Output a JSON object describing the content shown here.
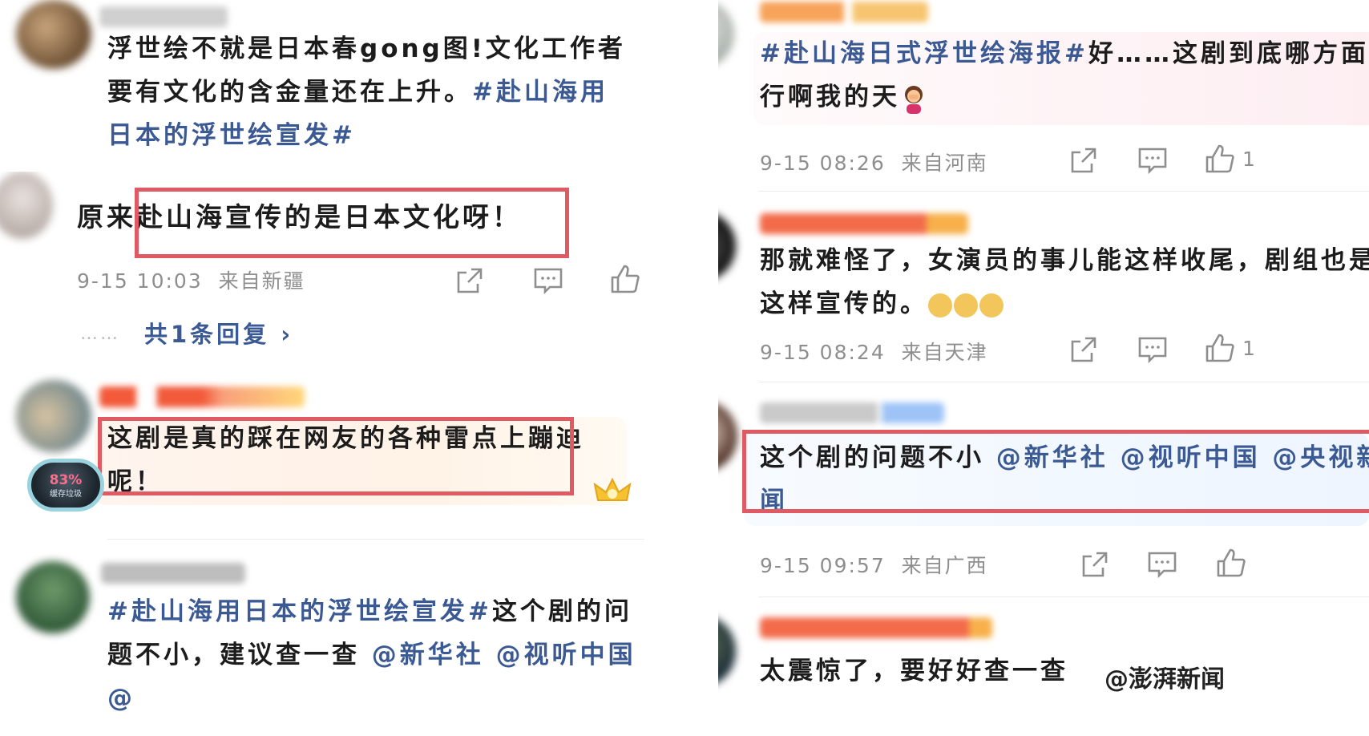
{
  "left": {
    "c1": {
      "text": "浮世绘不就是日本春gong图!文化工作者要有文化的含金量还在上升。",
      "tag": "#赴山海用日本的浮世绘宣发#"
    },
    "c2": {
      "prefix": "原来",
      "highlight": "赴山海宣传的是日本文化呀！",
      "time": "9-15 10:03",
      "location": "来自新疆",
      "replies_dots": "……",
      "replies": "共1条回复 ›"
    },
    "c3": {
      "text": "这剧是真的踩在网友的各种雷点上蹦迪呢！",
      "badge_pct": "83%",
      "badge_label": "缓存垃圾"
    },
    "c4": {
      "tag": "#赴山海用日本的浮世绘宣发#",
      "text": "这个剧的问题不小，建议查一查",
      "mentions": "@新华社 @视听中国 @"
    }
  },
  "right": {
    "c1": {
      "tag": "#赴山海日式浮世绘海报#",
      "text": "好……这剧到底哪方面行啊我的天",
      "time": "9-15 08:26",
      "location": "来自河南",
      "likes": "1"
    },
    "c2": {
      "text": "那就难怪了，女演员的事儿能这样收尾，剧组也是这样宣传的。",
      "time": "9-15 08:24",
      "location": "来自天津",
      "likes": "1"
    },
    "c3": {
      "text": "这个剧的问题不小",
      "mentions": "@新华社 @视听中国 @央视新闻",
      "time": "9-15 09:57",
      "location": "来自广西"
    },
    "c4": {
      "text": "太震惊了，要好好查一查",
      "watermark": "@澎湃新闻"
    }
  },
  "colors": {
    "text": "#1c1c1c",
    "link": "#3b5a94",
    "meta": "#8e8e8e",
    "highlight_border": "#e05a63"
  },
  "icons": [
    "share-icon",
    "comment-icon",
    "like-icon",
    "crown-icon",
    "facepalm-emoji",
    "doge-emoji"
  ]
}
